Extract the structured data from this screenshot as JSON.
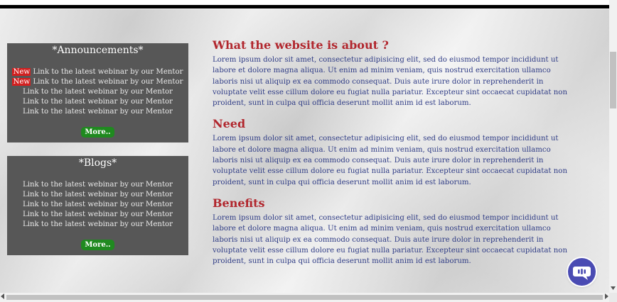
{
  "announcements": {
    "title": "*Announcements*",
    "new_label": "New",
    "items": [
      {
        "label": "Link to the latest webinar by our Mentor",
        "is_new": true
      },
      {
        "label": "Link to the latest webinar by our Mentor",
        "is_new": true
      },
      {
        "label": "Link to the latest webinar by our Mentor",
        "is_new": false
      },
      {
        "label": "Link to the latest webinar by our Mentor",
        "is_new": false
      },
      {
        "label": "Link to the latest webinar by our Mentor",
        "is_new": false
      }
    ],
    "more_label": "More.."
  },
  "blogs": {
    "title": "*Blogs*",
    "items": [
      {
        "label": "Link to the latest webinar by our Mentor"
      },
      {
        "label": "Link to the latest webinar by our Mentor"
      },
      {
        "label": "Link to the latest webinar by our Mentor"
      },
      {
        "label": "Link to the latest webinar by our Mentor"
      },
      {
        "label": "Link to the latest webinar by our Mentor"
      }
    ],
    "more_label": "More.."
  },
  "sections": [
    {
      "heading": "What the website is about ?",
      "body": "Lorem ipsum dolor sit amet, consectetur adipisicing elit, sed do eiusmod tempor incididunt ut labore et dolore magna aliqua. Ut enim ad minim veniam, quis nostrud exercitation ullamco laboris nisi ut aliquip ex ea commodo consequat. Duis aute irure dolor in reprehenderit in voluptate velit esse cillum dolore eu fugiat nulla pariatur. Excepteur sint occaecat cupidatat non proident, sunt in culpa qui officia deserunt mollit anim id est laborum."
    },
    {
      "heading": "Need",
      "body": "Lorem ipsum dolor sit amet, consectetur adipisicing elit, sed do eiusmod tempor incididunt ut labore et dolore magna aliqua. Ut enim ad minim veniam, quis nostrud exercitation ullamco laboris nisi ut aliquip ex ea commodo consequat. Duis aute irure dolor in reprehenderit in voluptate velit esse cillum dolore eu fugiat nulla pariatur. Excepteur sint occaecat cupidatat non proident, sunt in culpa qui officia deserunt mollit anim id est laborum."
    },
    {
      "heading": "Benefits",
      "body": "Lorem ipsum dolor sit amet, consectetur adipisicing elit, sed do eiusmod tempor incididunt ut labore et dolore magna aliqua. Ut enim ad minim veniam, quis nostrud exercitation ullamco laboris nisi ut aliquip ex ea commodo consequat. Duis aute irure dolor in reprehenderit in voluptate velit esse cillum dolore eu fugiat nulla pariatur. Excepteur sint occaecat cupidatat non proident, sunt in culpa qui officia deserunt mollit anim id est laborum."
    }
  ],
  "colors": {
    "heading": "#b1262d",
    "body_text": "#303d86",
    "panel_bg": "#575757",
    "new_badge": "#d22020",
    "more_button": "#1f8a1f",
    "chat_button": "#4a4bb3"
  },
  "icons": {
    "chat": "chat-bubble-icon",
    "scroll_up": "triangle-up-icon",
    "scroll_down": "triangle-down-icon",
    "scroll_left": "triangle-left-icon",
    "scroll_right": "triangle-right-icon"
  }
}
